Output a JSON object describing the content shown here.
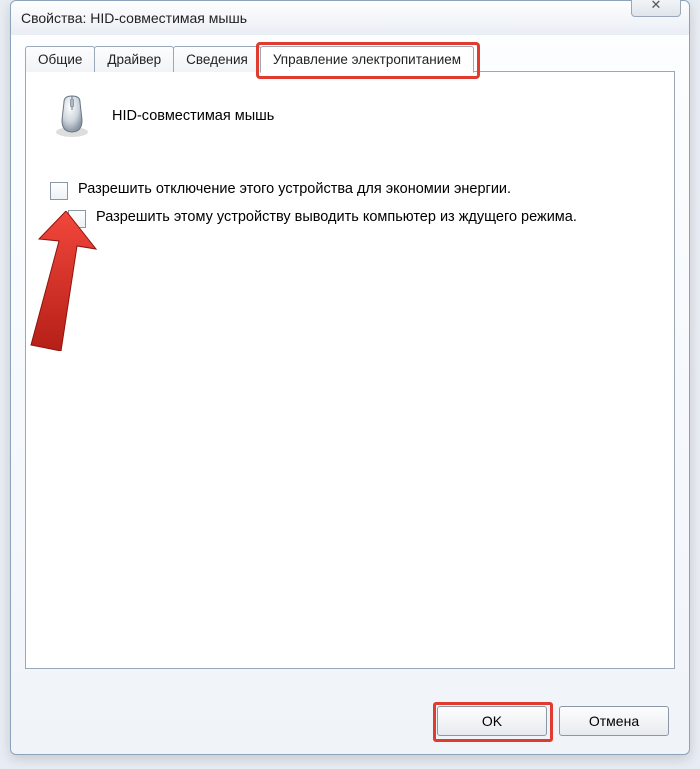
{
  "window": {
    "title": "Свойства: HID-совместимая мышь",
    "close_glyph": "✕"
  },
  "tabs": {
    "general": "Общие",
    "driver": "Драйвер",
    "details": "Сведения",
    "power": "Управление электропитанием"
  },
  "device": {
    "name": "HID-совместимая мышь"
  },
  "checkboxes": {
    "allow_off": "Разрешить отключение этого устройства для экономии энергии.",
    "allow_wake": "Разрешить этому устройству выводить компьютер из ждущего режима."
  },
  "buttons": {
    "ok": "OK",
    "cancel": "Отмена"
  },
  "annotation_colors": {
    "highlight": "#e13a2f"
  }
}
